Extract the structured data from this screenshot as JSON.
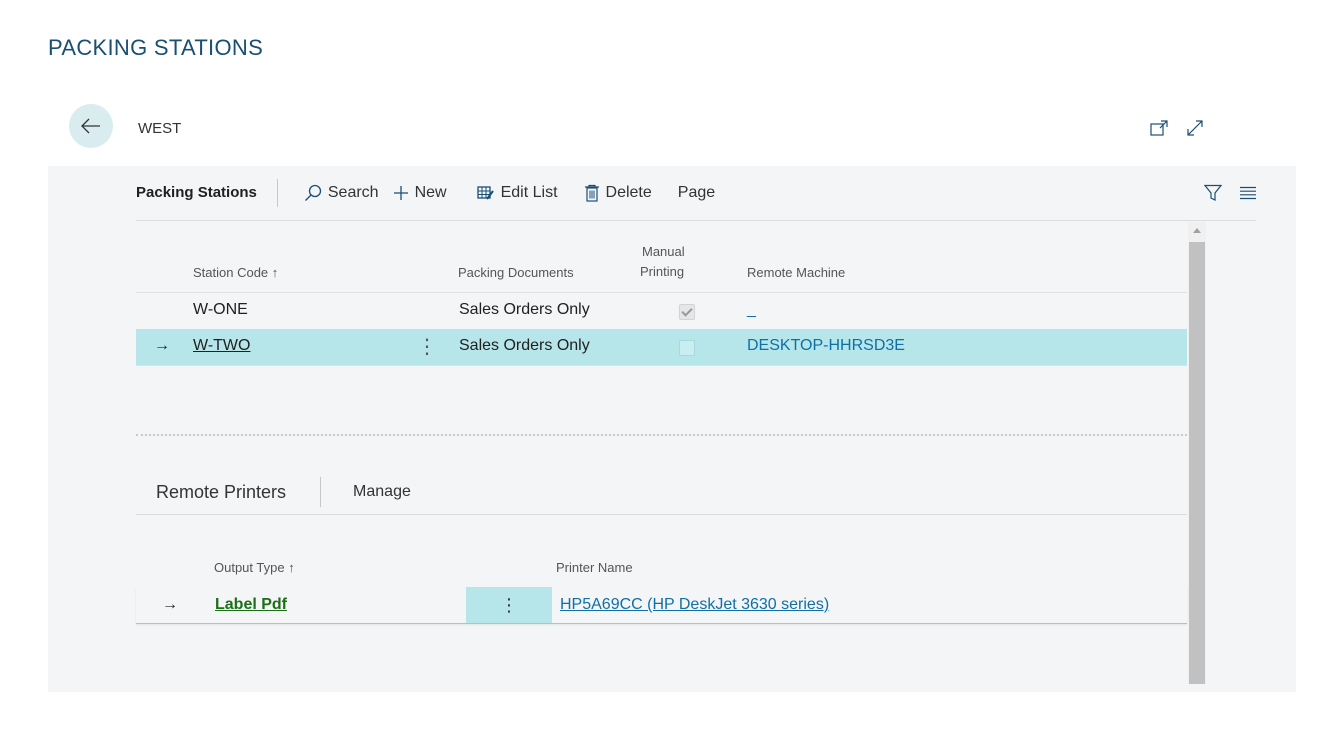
{
  "page": {
    "title": "PACKING STATIONS"
  },
  "record": {
    "title": "WEST"
  },
  "toolbar": {
    "caption": "Packing Stations",
    "search_label": "Search",
    "new_label": "New",
    "edit_list_label": "Edit List",
    "delete_label": "Delete",
    "page_label": "Page"
  },
  "table": {
    "headers": {
      "station_code": "Station Code ↑",
      "packing_documents": "Packing Documents",
      "manual_printing_line1": "Manual",
      "manual_printing_line2": "Printing",
      "remote_machine": "Remote Machine"
    },
    "rows": [
      {
        "station_code": "W-ONE",
        "packing_documents": "Sales Orders Only",
        "manual_printing": true,
        "remote_machine": "_"
      },
      {
        "station_code": "W-TWO",
        "packing_documents": "Sales Orders Only",
        "manual_printing": false,
        "remote_machine": "DESKTOP-HHRSD3E",
        "selected": true,
        "row_marker": "→",
        "menu_glyph": "⋮"
      }
    ]
  },
  "subpage": {
    "caption": "Remote Printers",
    "manage_label": "Manage",
    "headers": {
      "output_type": "Output Type ↑",
      "printer_name": "Printer Name"
    },
    "rows": [
      {
        "row_marker": "→",
        "output_type": "Label Pdf",
        "menu_glyph": "⋮",
        "printer_name": "HP5A69CC (HP DeskJet 3630 series)"
      }
    ]
  },
  "colors": {
    "accent": "#b6e6ea",
    "title": "#1a4f74",
    "link": "#0f6fa6",
    "green_link": "#1d6f17"
  }
}
